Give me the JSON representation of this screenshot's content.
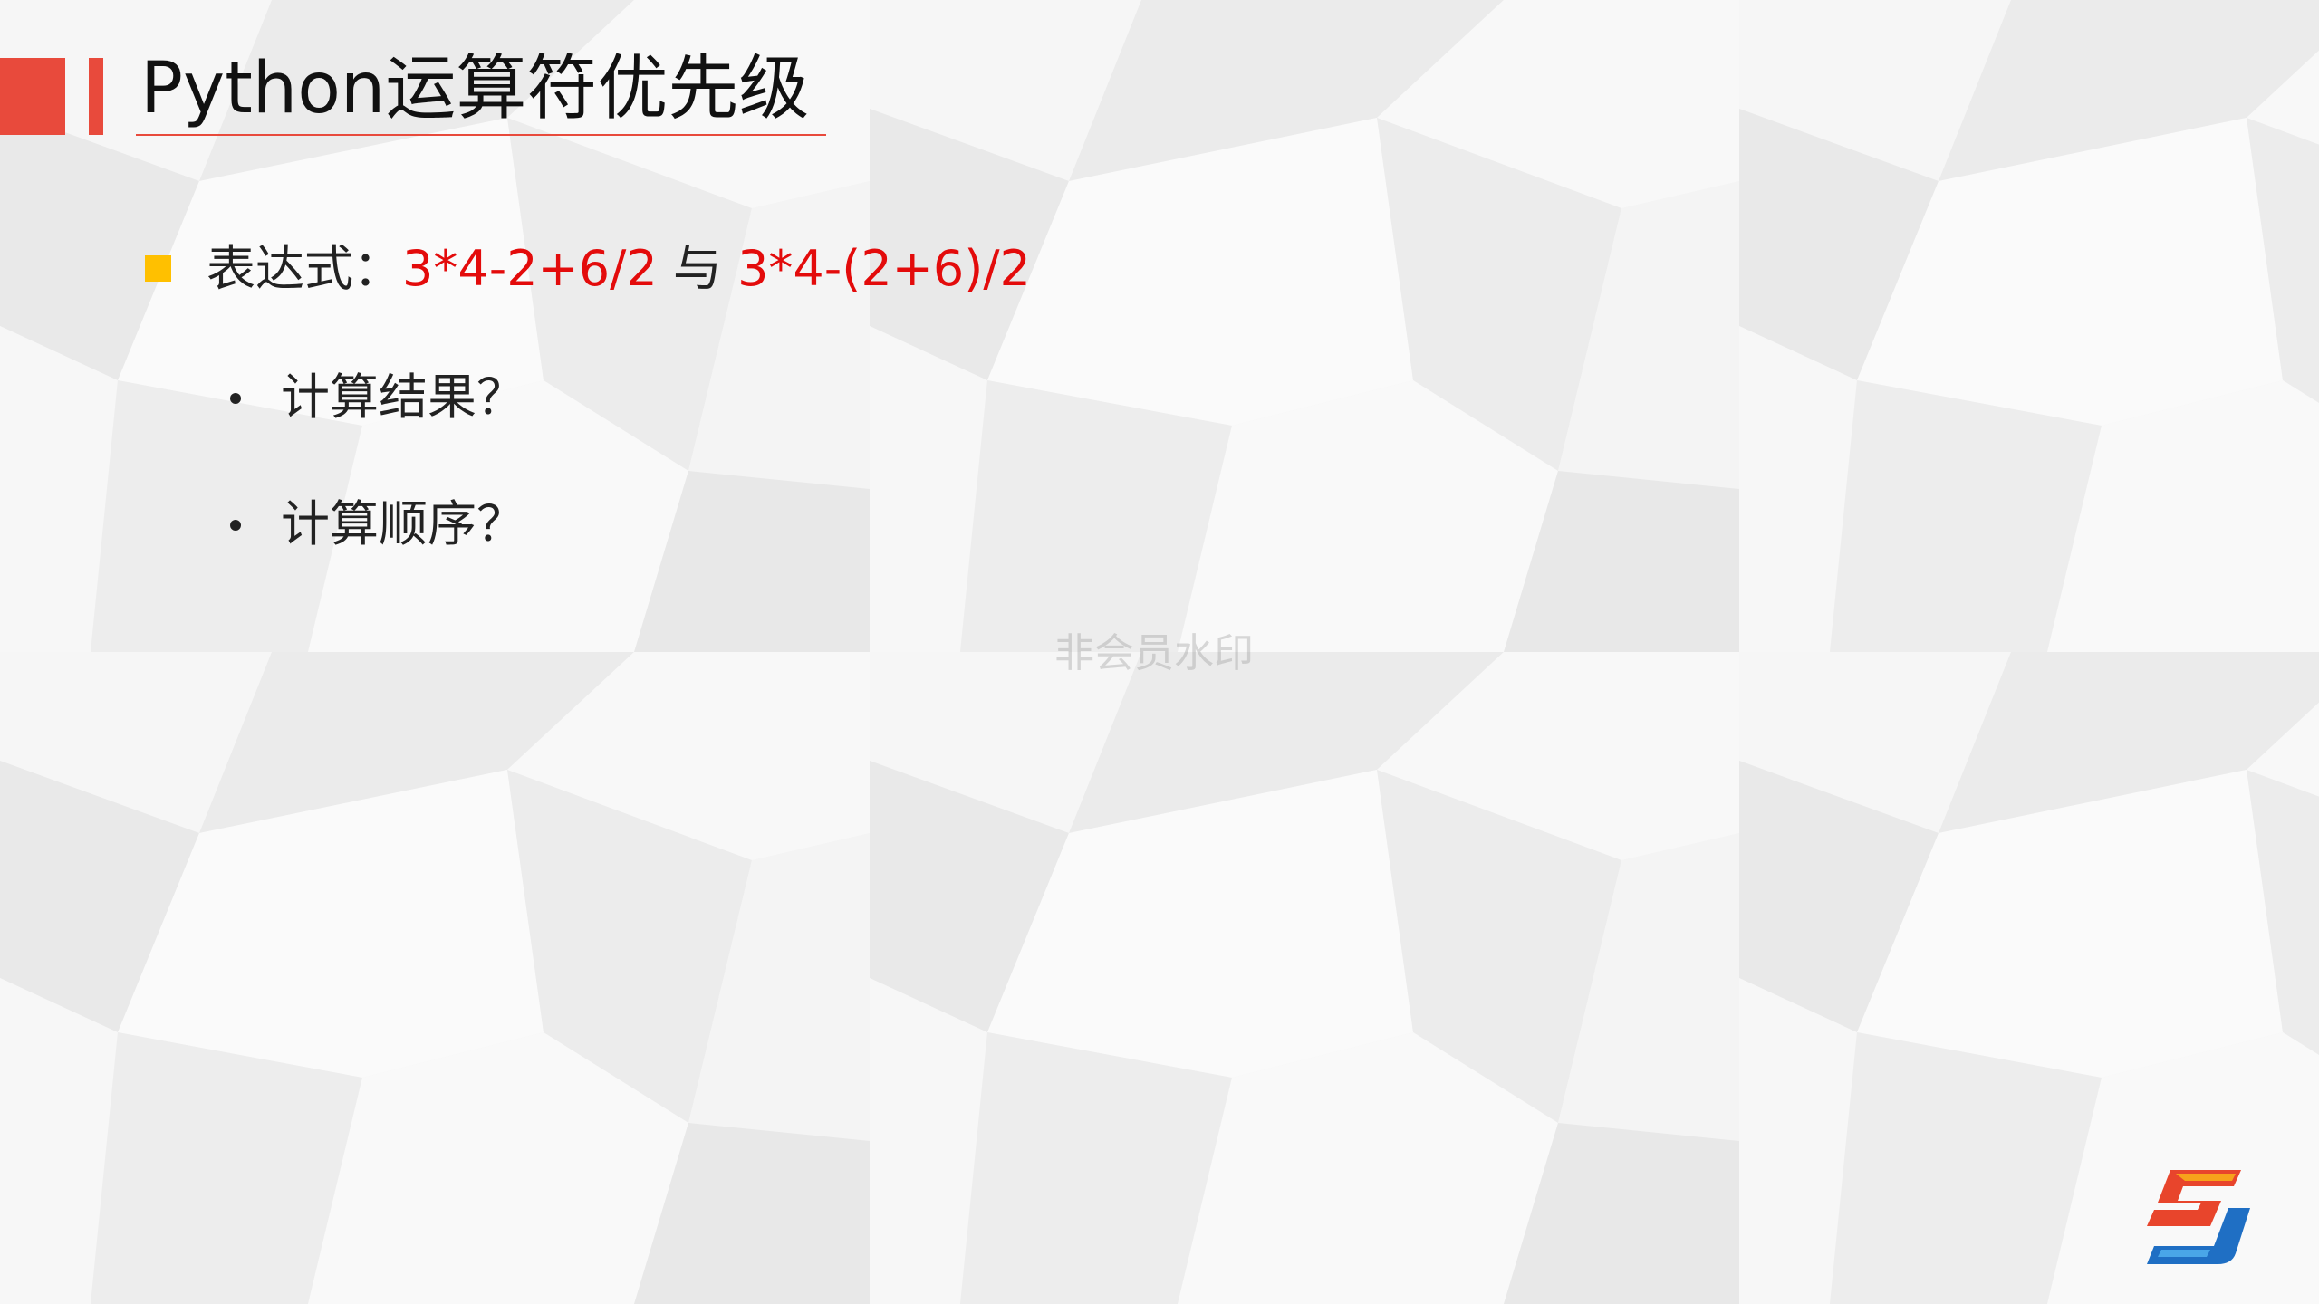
{
  "slide": {
    "title": "Python运算符优先级",
    "accent_color": "#e84a3c",
    "bullet_color": "#ffc000",
    "expression_color": "#e30b0b"
  },
  "content": {
    "main_bullet": {
      "label": "表达式：",
      "expression_1": "3*4-2+6/2",
      "connector": " 与 ",
      "expression_2": "3*4-(2+6)/2"
    },
    "sub_bullets": [
      {
        "text": "计算结果？"
      },
      {
        "text": "计算顺序？"
      }
    ]
  },
  "watermark": {
    "text": "非会员水印"
  },
  "logo": {
    "icon": "sj-logo-icon"
  }
}
